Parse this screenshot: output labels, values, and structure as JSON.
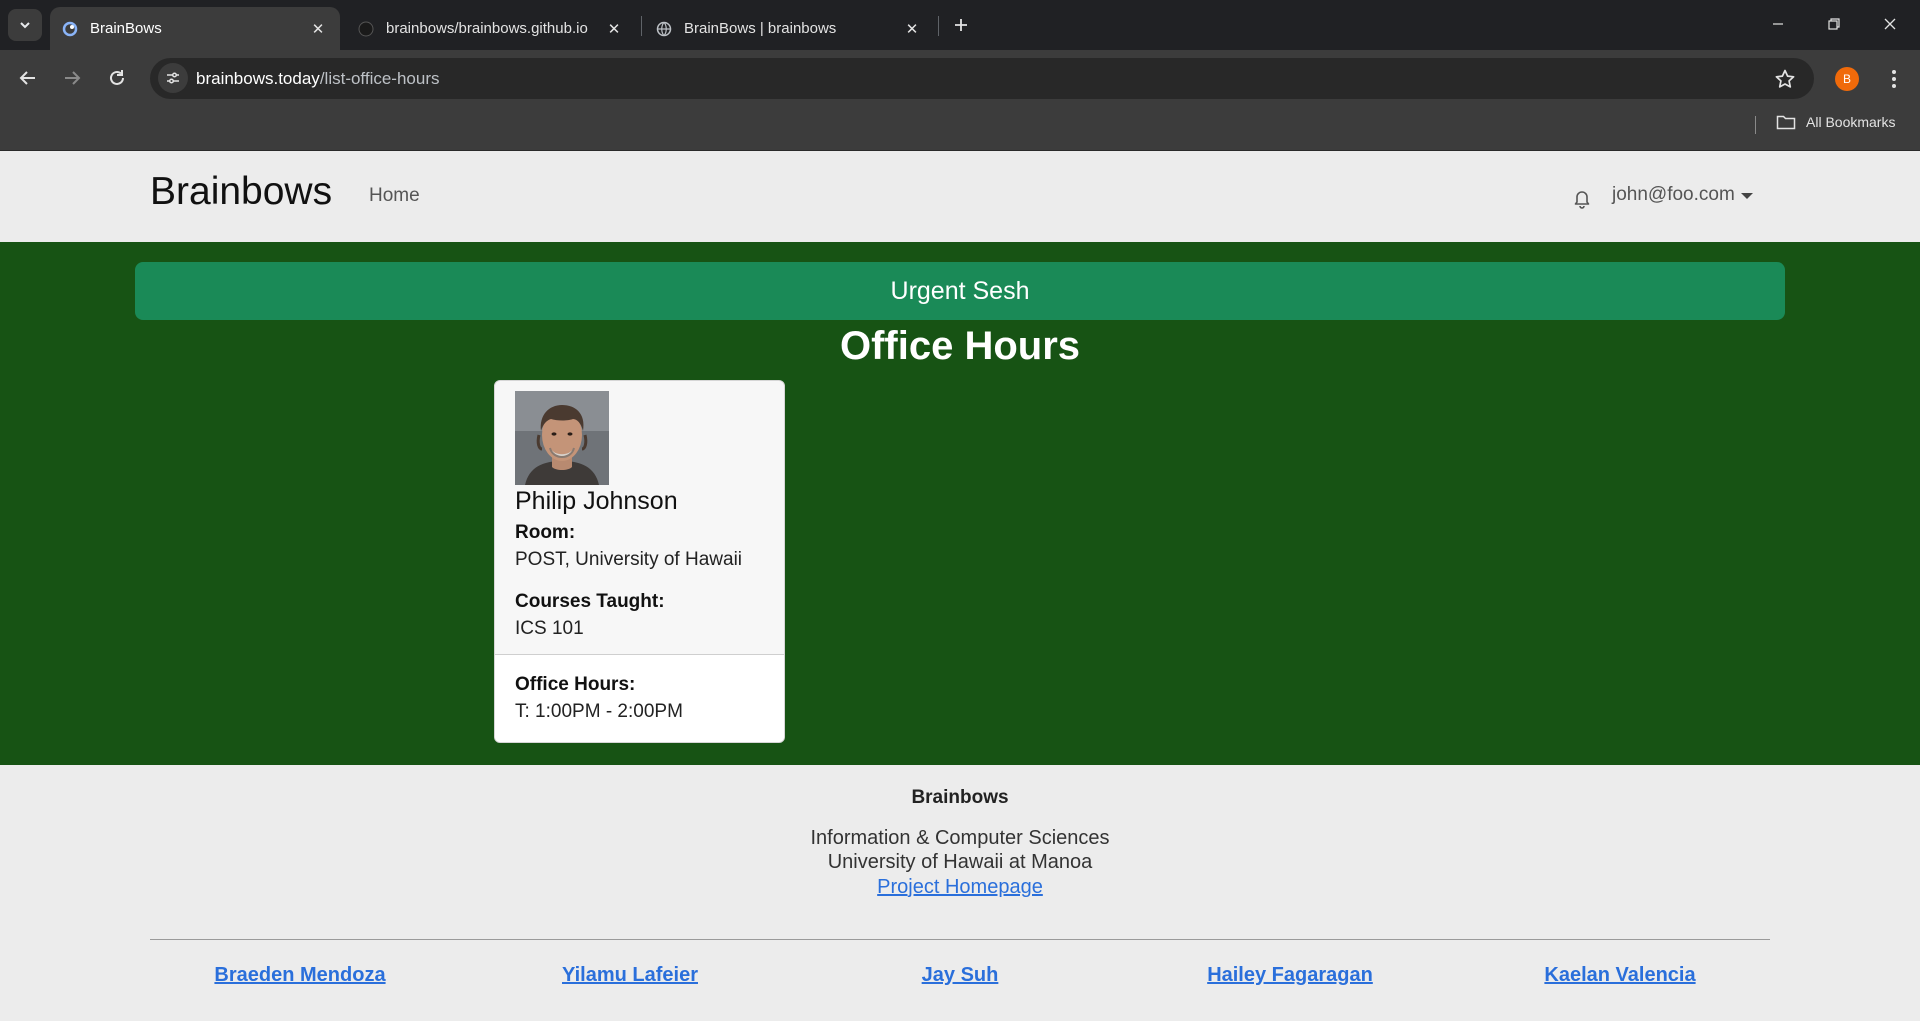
{
  "browser": {
    "tabs": [
      {
        "title": "BrainBows",
        "active": true
      },
      {
        "title": "brainbows/brainbows.github.io",
        "active": false
      },
      {
        "title": "BrainBows | brainbows",
        "active": false
      }
    ],
    "url_host": "brainbows.today",
    "url_path": "/list-office-hours",
    "profile_initial": "B",
    "bookmarks_label": "All Bookmarks"
  },
  "navbar": {
    "brand": "Brainbows",
    "home_label": "Home",
    "user_email": "john@foo.com"
  },
  "main": {
    "urgent_button_label": "Urgent Sesh",
    "page_title": "Office Hours",
    "cards": [
      {
        "name": "Philip Johnson",
        "room_label": "Room:",
        "room": "POST, University of Hawaii",
        "courses_label": "Courses Taught:",
        "courses": "ICS 101",
        "hours_label": "Office Hours:",
        "hours": "T: 1:00PM - 2:00PM"
      }
    ]
  },
  "footer": {
    "title": "Brainbows",
    "line1": "Information & Computer Sciences",
    "line2": "University of Hawaii at Manoa",
    "project_link": "Project Homepage",
    "team": [
      "Braeden Mendoza",
      "Yilamu Lafeier",
      "Jay Suh",
      "Hailey Fagaragan",
      "Kaelan Valencia"
    ]
  },
  "colors": {
    "main_background": "#175314",
    "urgent_button": "#1a8a57",
    "link": "#2a6fdb",
    "profile_avatar": "#f06a0a"
  }
}
